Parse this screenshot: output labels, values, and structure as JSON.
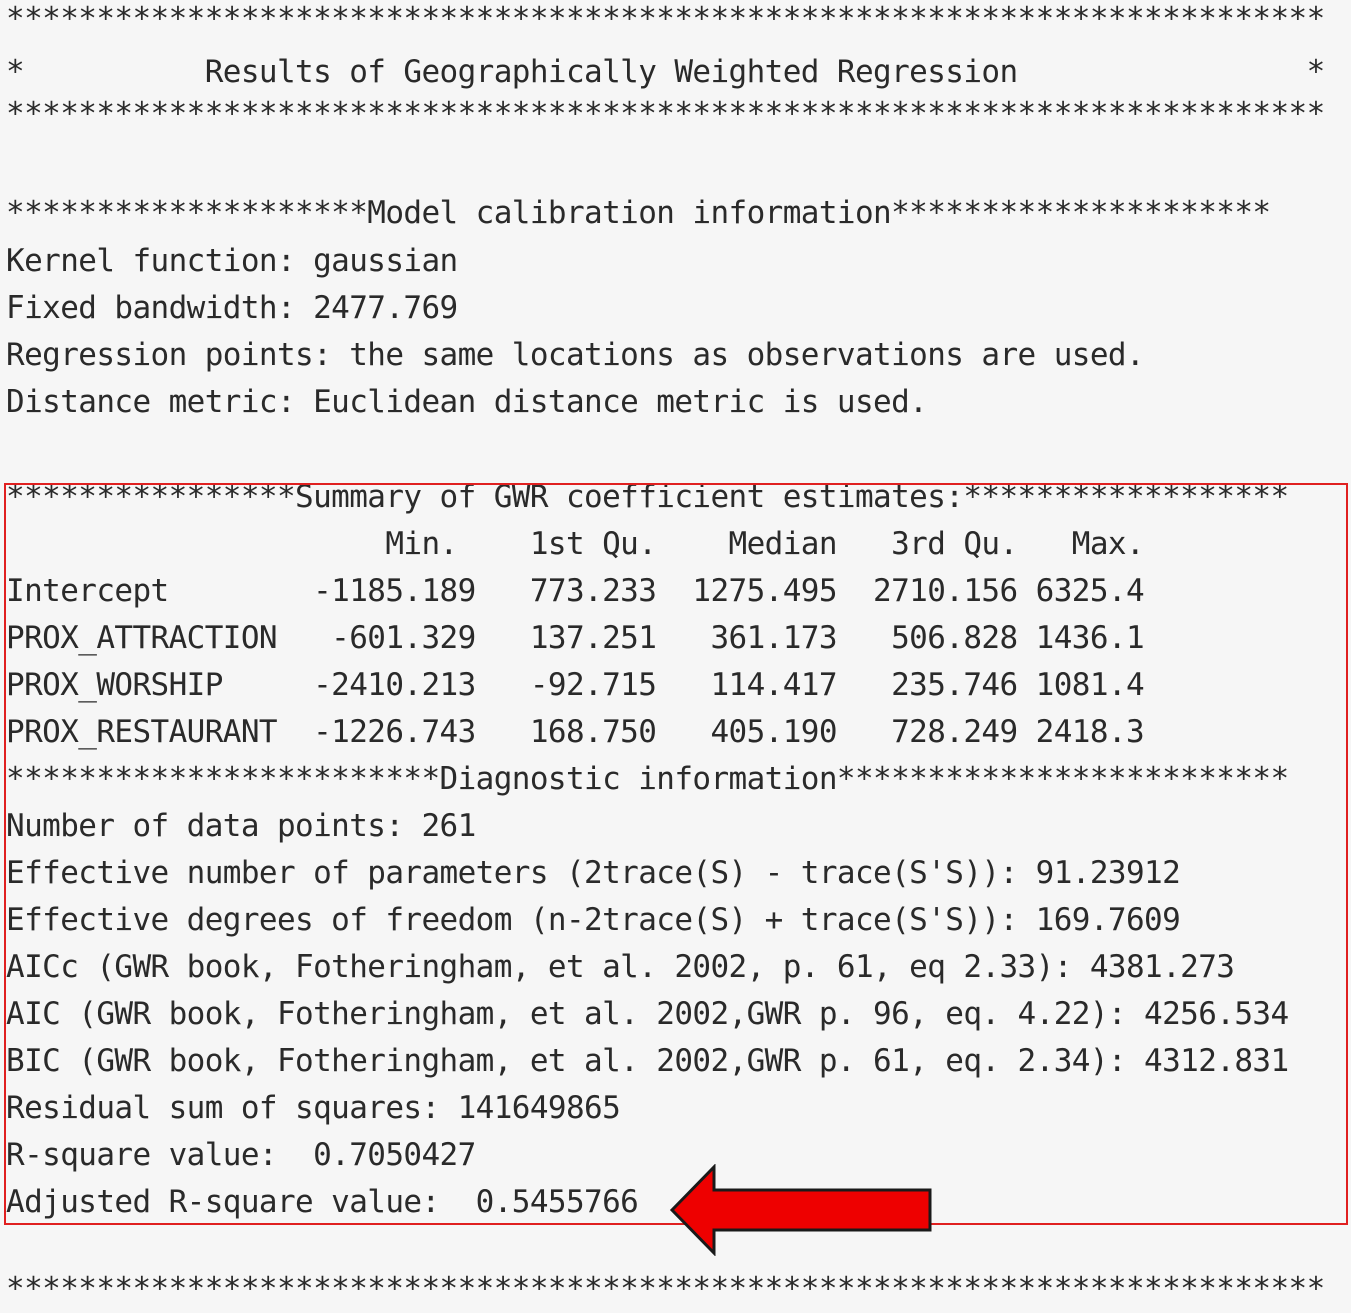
{
  "header": {
    "stars": "*************************************************************************",
    "title_line": "*          Results of Geographically Weighted Regression                *"
  },
  "calibration": {
    "heading": "********************Model calibration information*********************",
    "kernel": "Kernel function: gaussian",
    "bandwidth": "Fixed bandwidth: 2477.769",
    "regression_points": "Regression points: the same locations as observations are used.",
    "distance_metric": "Distance metric: Euclidean distance metric is used."
  },
  "summary": {
    "heading": "****************Summary of GWR coefficient estimates:******************",
    "columns": [
      "Min.",
      "1st Qu.",
      "Median",
      "3rd Qu.",
      "Max."
    ],
    "header_line": "                     Min.    1st Qu.    Median   3rd Qu.   Max.",
    "rows": [
      {
        "name": "Intercept",
        "values": [
          "-1185.189",
          "773.233",
          "1275.495",
          "2710.156",
          "6325.4"
        ],
        "line": "Intercept        -1185.189   773.233  1275.495  2710.156 6325.4"
      },
      {
        "name": "PROX_ATTRACTION",
        "values": [
          "-601.329",
          "137.251",
          "361.173",
          "506.828",
          "1436.1"
        ],
        "line": "PROX_ATTRACTION   -601.329   137.251   361.173   506.828 1436.1"
      },
      {
        "name": "PROX_WORSHIP",
        "values": [
          "-2410.213",
          "-92.715",
          "114.417",
          "235.746",
          "1081.4"
        ],
        "line": "PROX_WORSHIP     -2410.213   -92.715   114.417   235.746 1081.4"
      },
      {
        "name": "PROX_RESTAURANT",
        "values": [
          "-1226.743",
          "168.750",
          "405.190",
          "728.249",
          "2418.3"
        ],
        "line": "PROX_RESTAURANT  -1226.743   168.750   405.190   728.249 2418.3"
      }
    ]
  },
  "diagnostics": {
    "heading": "************************Diagnostic information*************************",
    "data_points": "Number of data points: 261",
    "effective_params": "Effective number of parameters (2trace(S) - trace(S'S)): 91.23912",
    "effective_dof": "Effective degrees of freedom (n-2trace(S) + trace(S'S)): 169.7609",
    "aicc": "AICc (GWR book, Fotheringham, et al. 2002, p. 61, eq 2.33): 4381.273",
    "aic": "AIC (GWR book, Fotheringham, et al. 2002,GWR p. 96, eq. 4.22): 4256.534",
    "bic": "BIC (GWR book, Fotheringham, et al. 2002,GWR p. 61, eq. 2.34): 4312.831",
    "rss": "Residual sum of squares: 141649865",
    "r_square": "R-square value:  0.7050427",
    "adj_r_square": "Adjusted R-square value:  0.5455766"
  },
  "footer": {
    "stars": "*************************************************************************"
  },
  "colors": {
    "background": "#f6f6f6",
    "text": "#2a2a2a",
    "highlight": "#e02020",
    "arrow_fill": "#ee0000"
  },
  "icons": {
    "arrow": "left-arrow-icon"
  }
}
